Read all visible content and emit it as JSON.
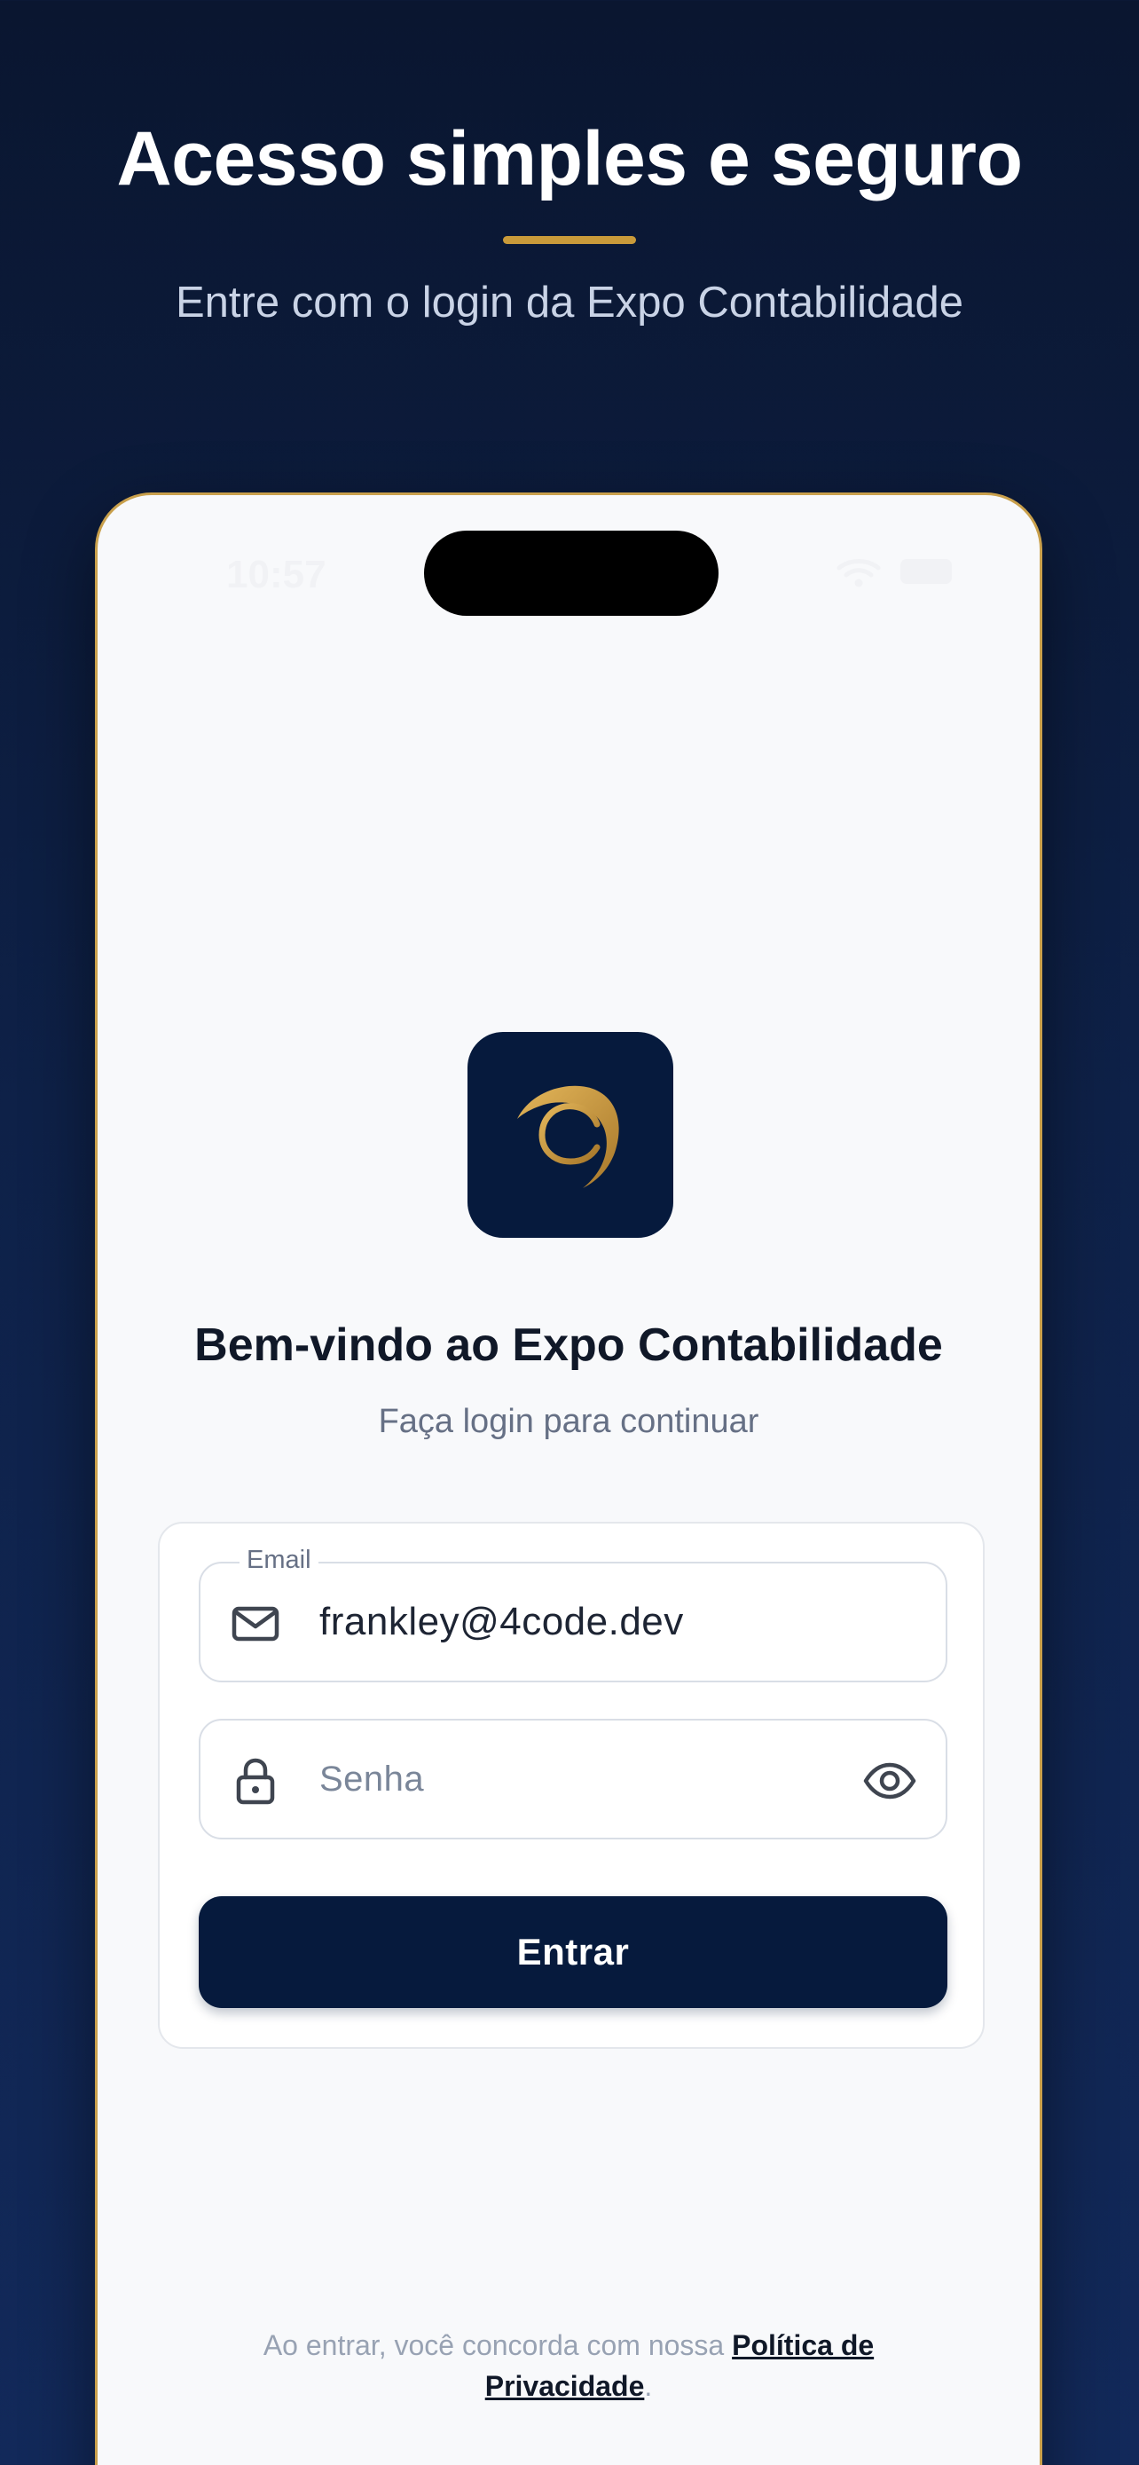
{
  "hero": {
    "title": "Acesso simples e seguro",
    "subtitle": "Entre com o login da Expo Contabilidade"
  },
  "status_bar": {
    "time": "10:57"
  },
  "app": {
    "logo_icon": "expo-contabilidade-logo",
    "welcome_title": "Bem-vindo ao Expo Contabilidade",
    "welcome_subtitle": "Faça login para continuar"
  },
  "form": {
    "email": {
      "label": "Email",
      "value": "frankley@4code.dev",
      "icon": "mail-icon"
    },
    "password": {
      "placeholder": "Senha",
      "icon": "lock-icon",
      "toggle_icon": "eye-icon"
    },
    "submit_label": "Entrar"
  },
  "footer": {
    "prefix": "Ao entrar, você concorda com nossa",
    "link": "Política de Privacidade",
    "suffix": "."
  },
  "colors": {
    "background_top": "#0a1630",
    "background_bottom": "#12295a",
    "accent_gold": "#c99a3a",
    "primary_navy": "#061a3d",
    "screen_background": "#f8f9fb"
  }
}
